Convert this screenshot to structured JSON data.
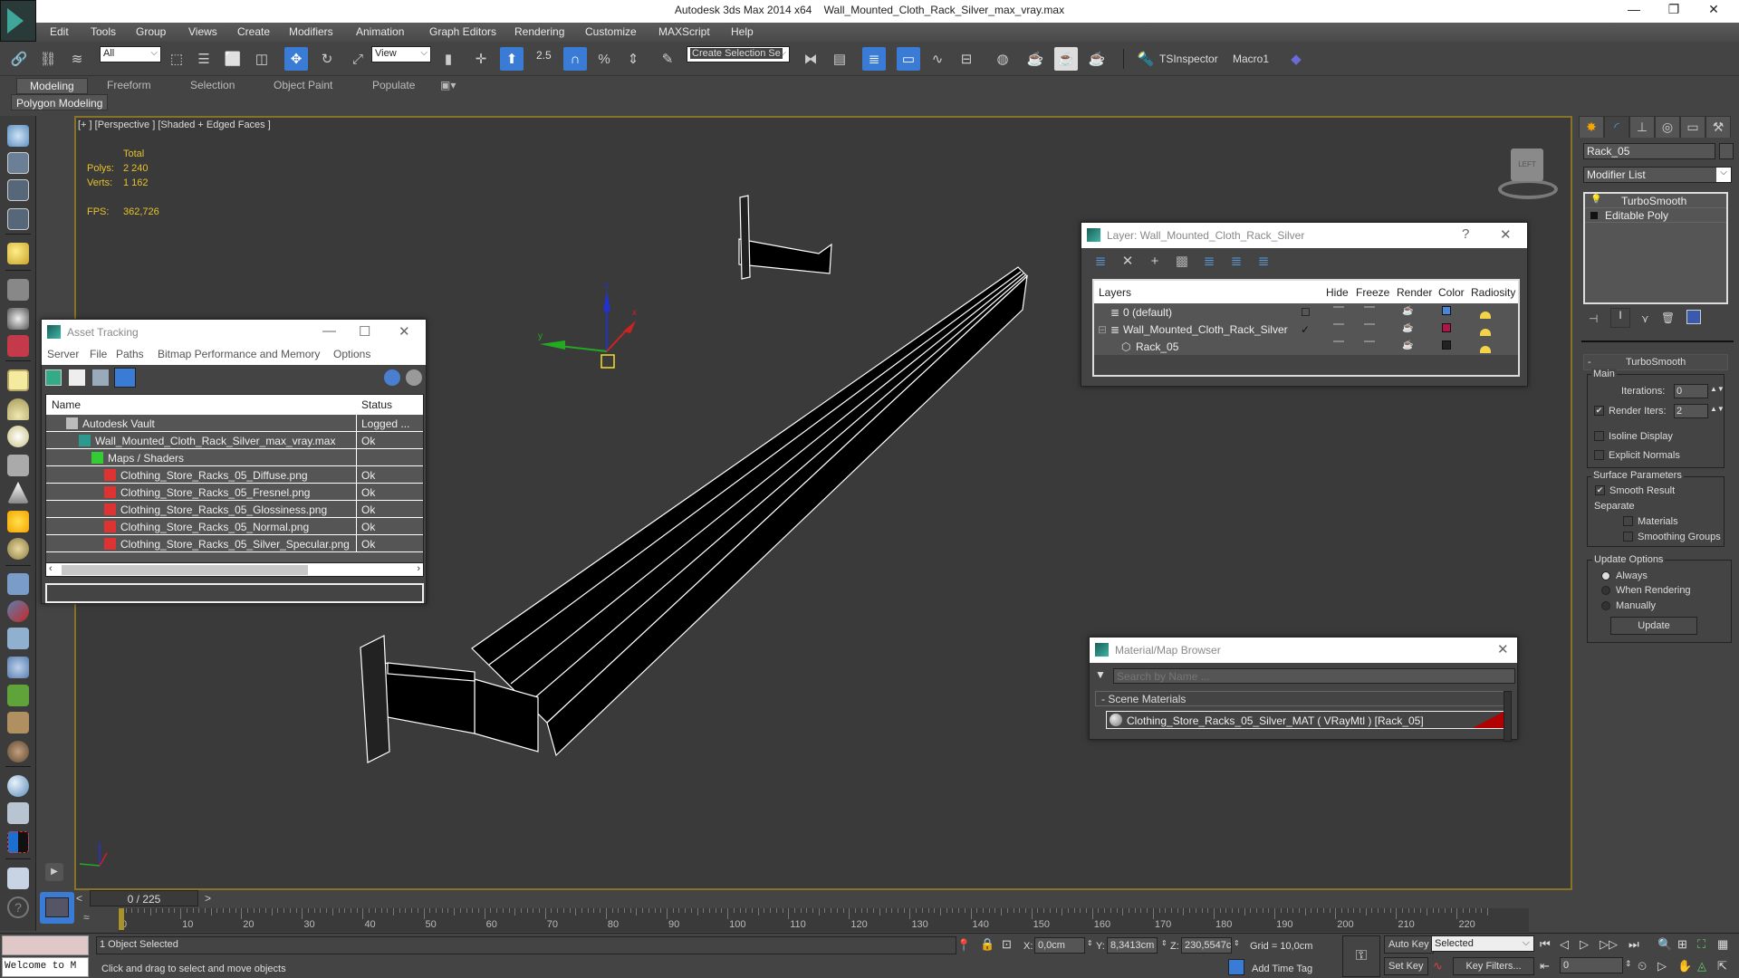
{
  "window": {
    "app_title": "Autodesk 3ds Max  2014 x64",
    "file_title": "Wall_Mounted_Cloth_Rack_Silver_max_vray.max",
    "minimize_glyph": "—",
    "restore_glyph": "❐",
    "close_glyph": "✕"
  },
  "menu": [
    "Edit",
    "Tools",
    "Group",
    "Views",
    "Create",
    "Modifiers",
    "Animation",
    "Graph Editors",
    "Rendering",
    "Customize",
    "MAXScript",
    "Help"
  ],
  "toolbar": {
    "selection_filter": "All",
    "ref_coord": "View",
    "snap_angle_label": "2.5",
    "named_selection_placeholder": "Create Selection Se",
    "ts_inspector": "TSInspector",
    "macro1": "Macro1"
  },
  "ribbon": {
    "tabs": [
      "Modeling",
      "Freeform",
      "Selection",
      "Object Paint",
      "Populate"
    ],
    "active_tab": "Modeling",
    "panel_label": "Polygon Modeling"
  },
  "viewport": {
    "label": "[+ ] [Perspective ] [Shaded + Edged Faces ]",
    "stats": {
      "total_label": "Total",
      "polys_label": "Polys:",
      "polys_value": "2 240",
      "verts_label": "Verts:",
      "verts_value": "1 162",
      "fps_label": "FPS:",
      "fps_value": "362,726"
    },
    "viewcube_face": "LEFT",
    "axis_labels": {
      "x": "x",
      "y": "y",
      "z": "z"
    },
    "colors": {
      "frame": "#877227",
      "x_axis": "#cc2222",
      "y_axis": "#22aa22",
      "z_axis": "#2233cc",
      "stats": "#e6c229"
    }
  },
  "asset_tracking": {
    "title": "Asset Tracking",
    "menus": [
      "Server",
      "File",
      "Paths",
      "Bitmap Performance and Memory",
      "Options"
    ],
    "columns": [
      "Name",
      "Status"
    ],
    "rows": [
      {
        "name": "Autodesk Vault",
        "status": "Logged ...",
        "icon": "vault-icon",
        "indent": 1
      },
      {
        "name": "Wall_Mounted_Cloth_Rack_Silver_max_vray.max",
        "status": "Ok",
        "icon": "max-file-icon",
        "indent": 2
      },
      {
        "name": "Maps / Shaders",
        "status": "",
        "icon": "maps-icon",
        "indent": 3
      },
      {
        "name": "Clothing_Store_Racks_05_Diffuse.png",
        "status": "Ok",
        "icon": "image-file-icon",
        "indent": 4
      },
      {
        "name": "Clothing_Store_Racks_05_Fresnel.png",
        "status": "Ok",
        "icon": "image-file-icon",
        "indent": 4
      },
      {
        "name": "Clothing_Store_Racks_05_Glossiness.png",
        "status": "Ok",
        "icon": "image-file-icon",
        "indent": 4
      },
      {
        "name": "Clothing_Store_Racks_05_Normal.png",
        "status": "Ok",
        "icon": "image-file-icon",
        "indent": 4
      },
      {
        "name": "Clothing_Store_Racks_05_Silver_Specular.png",
        "status": "Ok",
        "icon": "image-file-icon",
        "indent": 4
      }
    ],
    "path_value": ""
  },
  "layer_dialog": {
    "title": "Layer: Wall_Mounted_Cloth_Rack_Silver",
    "help_glyph": "?",
    "columns": [
      "Layers",
      "",
      "Hide",
      "Freeze",
      "Render",
      "Color",
      "Radiosity"
    ],
    "rows": [
      {
        "name": "0 (default)",
        "current": "☐",
        "color": "#4a86d8"
      },
      {
        "name": "Wall_Mounted_Cloth_Rack_Silver",
        "current": "✓",
        "color": "#b0144a",
        "expander": "⊟"
      },
      {
        "name": "Rack_05",
        "current": "",
        "color": "#222222"
      }
    ]
  },
  "material_browser": {
    "title": "Material/Map Browser",
    "search_placeholder": "Search by Name ...",
    "section": "- Scene Materials",
    "material": "Clothing_Store_Racks_05_Silver_MAT  ( VRayMtl )  [Rack_05]",
    "material_accent": "#b30000"
  },
  "command_panel": {
    "object_name": "Rack_05",
    "modifier_list": "Modifier List",
    "stack": [
      "TurboSmooth",
      "Editable Poly"
    ],
    "rollout_title": "TurboSmooth",
    "rollout_collapse": "-",
    "main_group": "Main",
    "iterations_label": "Iterations:",
    "iterations_value": "0",
    "render_iters_label": "Render Iters:",
    "render_iters_value": "2",
    "render_iters_checked": true,
    "isoline_label": "Isoline Display",
    "isoline_checked": false,
    "explicit_normals_label": "Explicit Normals",
    "explicit_normals_checked": false,
    "surface_group": "Surface Parameters",
    "smooth_result_label": "Smooth Result",
    "smooth_result_checked": true,
    "separate_label": "Separate",
    "materials_label": "Materials",
    "smoothing_groups_label": "Smoothing Groups",
    "update_group": "Update Options",
    "update_options": [
      "Always",
      "When Rendering",
      "Manually"
    ],
    "update_selected": "Always",
    "update_button": "Update"
  },
  "timeline": {
    "frame_display": "0 / 225",
    "current_frame": 0,
    "total_frames": 225,
    "ticks": [
      0,
      10,
      20,
      30,
      40,
      50,
      60,
      70,
      80,
      90,
      100,
      110,
      120,
      130,
      140,
      150,
      160,
      170,
      180,
      190,
      200,
      210,
      220
    ],
    "prev_glyph": "<",
    "next_glyph": ">"
  },
  "status": {
    "listener_text": "Welcome to M",
    "selection": "1 Object Selected",
    "prompt": "Click and drag to select and move objects",
    "x_label": "X:",
    "x_value": "0,0cm",
    "y_label": "Y:",
    "y_value": "8,3413cm",
    "z_label": "Z:",
    "z_value": "230,5547c",
    "grid": "Grid = 10,0cm",
    "add_time_tag": "Add Time Tag",
    "auto_key": "Auto Key",
    "set_key": "Set Key",
    "key_mode": "Selected",
    "key_filters": "Key Filters...",
    "frame_field": "0"
  }
}
